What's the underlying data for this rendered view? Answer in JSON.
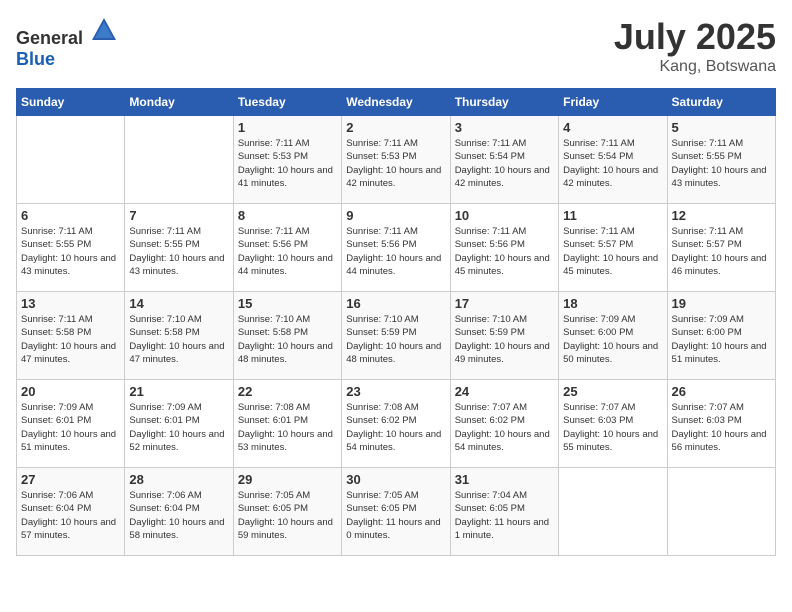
{
  "header": {
    "logo_general": "General",
    "logo_blue": "Blue",
    "month": "July 2025",
    "location": "Kang, Botswana"
  },
  "weekdays": [
    "Sunday",
    "Monday",
    "Tuesday",
    "Wednesday",
    "Thursday",
    "Friday",
    "Saturday"
  ],
  "weeks": [
    [
      {
        "day": "",
        "info": ""
      },
      {
        "day": "",
        "info": ""
      },
      {
        "day": "1",
        "info": "Sunrise: 7:11 AM\nSunset: 5:53 PM\nDaylight: 10 hours and 41 minutes."
      },
      {
        "day": "2",
        "info": "Sunrise: 7:11 AM\nSunset: 5:53 PM\nDaylight: 10 hours and 42 minutes."
      },
      {
        "day": "3",
        "info": "Sunrise: 7:11 AM\nSunset: 5:54 PM\nDaylight: 10 hours and 42 minutes."
      },
      {
        "day": "4",
        "info": "Sunrise: 7:11 AM\nSunset: 5:54 PM\nDaylight: 10 hours and 42 minutes."
      },
      {
        "day": "5",
        "info": "Sunrise: 7:11 AM\nSunset: 5:55 PM\nDaylight: 10 hours and 43 minutes."
      }
    ],
    [
      {
        "day": "6",
        "info": "Sunrise: 7:11 AM\nSunset: 5:55 PM\nDaylight: 10 hours and 43 minutes."
      },
      {
        "day": "7",
        "info": "Sunrise: 7:11 AM\nSunset: 5:55 PM\nDaylight: 10 hours and 43 minutes."
      },
      {
        "day": "8",
        "info": "Sunrise: 7:11 AM\nSunset: 5:56 PM\nDaylight: 10 hours and 44 minutes."
      },
      {
        "day": "9",
        "info": "Sunrise: 7:11 AM\nSunset: 5:56 PM\nDaylight: 10 hours and 44 minutes."
      },
      {
        "day": "10",
        "info": "Sunrise: 7:11 AM\nSunset: 5:56 PM\nDaylight: 10 hours and 45 minutes."
      },
      {
        "day": "11",
        "info": "Sunrise: 7:11 AM\nSunset: 5:57 PM\nDaylight: 10 hours and 45 minutes."
      },
      {
        "day": "12",
        "info": "Sunrise: 7:11 AM\nSunset: 5:57 PM\nDaylight: 10 hours and 46 minutes."
      }
    ],
    [
      {
        "day": "13",
        "info": "Sunrise: 7:11 AM\nSunset: 5:58 PM\nDaylight: 10 hours and 47 minutes."
      },
      {
        "day": "14",
        "info": "Sunrise: 7:10 AM\nSunset: 5:58 PM\nDaylight: 10 hours and 47 minutes."
      },
      {
        "day": "15",
        "info": "Sunrise: 7:10 AM\nSunset: 5:58 PM\nDaylight: 10 hours and 48 minutes."
      },
      {
        "day": "16",
        "info": "Sunrise: 7:10 AM\nSunset: 5:59 PM\nDaylight: 10 hours and 48 minutes."
      },
      {
        "day": "17",
        "info": "Sunrise: 7:10 AM\nSunset: 5:59 PM\nDaylight: 10 hours and 49 minutes."
      },
      {
        "day": "18",
        "info": "Sunrise: 7:09 AM\nSunset: 6:00 PM\nDaylight: 10 hours and 50 minutes."
      },
      {
        "day": "19",
        "info": "Sunrise: 7:09 AM\nSunset: 6:00 PM\nDaylight: 10 hours and 51 minutes."
      }
    ],
    [
      {
        "day": "20",
        "info": "Sunrise: 7:09 AM\nSunset: 6:01 PM\nDaylight: 10 hours and 51 minutes."
      },
      {
        "day": "21",
        "info": "Sunrise: 7:09 AM\nSunset: 6:01 PM\nDaylight: 10 hours and 52 minutes."
      },
      {
        "day": "22",
        "info": "Sunrise: 7:08 AM\nSunset: 6:01 PM\nDaylight: 10 hours and 53 minutes."
      },
      {
        "day": "23",
        "info": "Sunrise: 7:08 AM\nSunset: 6:02 PM\nDaylight: 10 hours and 54 minutes."
      },
      {
        "day": "24",
        "info": "Sunrise: 7:07 AM\nSunset: 6:02 PM\nDaylight: 10 hours and 54 minutes."
      },
      {
        "day": "25",
        "info": "Sunrise: 7:07 AM\nSunset: 6:03 PM\nDaylight: 10 hours and 55 minutes."
      },
      {
        "day": "26",
        "info": "Sunrise: 7:07 AM\nSunset: 6:03 PM\nDaylight: 10 hours and 56 minutes."
      }
    ],
    [
      {
        "day": "27",
        "info": "Sunrise: 7:06 AM\nSunset: 6:04 PM\nDaylight: 10 hours and 57 minutes."
      },
      {
        "day": "28",
        "info": "Sunrise: 7:06 AM\nSunset: 6:04 PM\nDaylight: 10 hours and 58 minutes."
      },
      {
        "day": "29",
        "info": "Sunrise: 7:05 AM\nSunset: 6:05 PM\nDaylight: 10 hours and 59 minutes."
      },
      {
        "day": "30",
        "info": "Sunrise: 7:05 AM\nSunset: 6:05 PM\nDaylight: 11 hours and 0 minutes."
      },
      {
        "day": "31",
        "info": "Sunrise: 7:04 AM\nSunset: 6:05 PM\nDaylight: 11 hours and 1 minute."
      },
      {
        "day": "",
        "info": ""
      },
      {
        "day": "",
        "info": ""
      }
    ]
  ]
}
